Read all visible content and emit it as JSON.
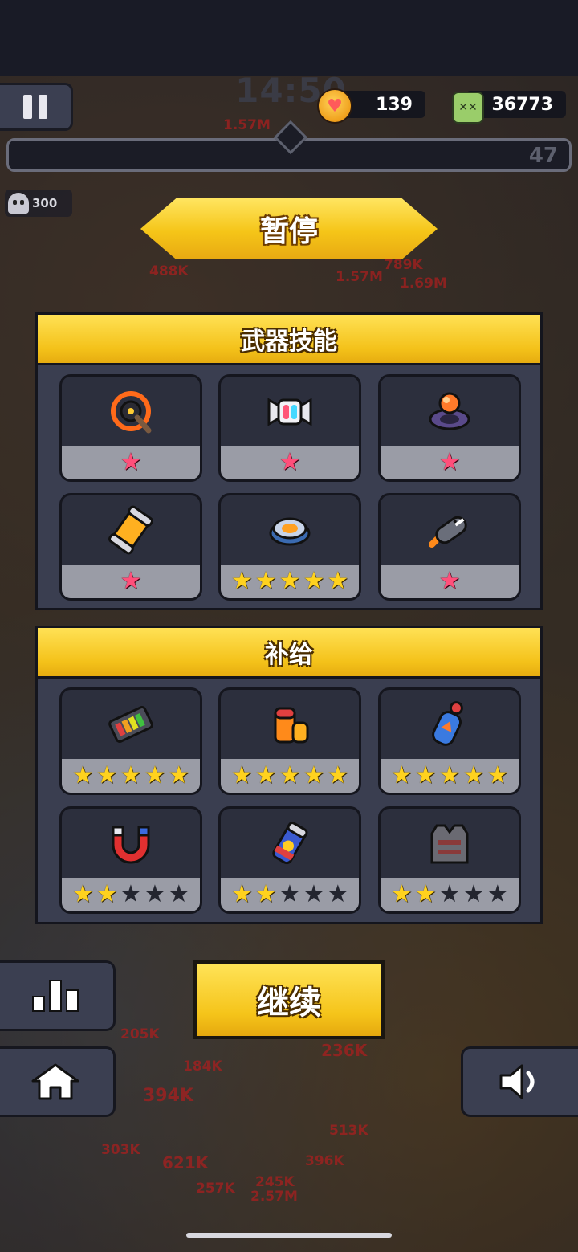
{
  "hud": {
    "timer": "14:50",
    "hearts": "139",
    "kills": "36773",
    "level": "47",
    "ghost_count": "300"
  },
  "dialog": {
    "title": "暂停",
    "weapons_section": {
      "title": "武器技能",
      "items": [
        {
          "icon": "fire-drill-weapon-icon",
          "stars": 1,
          "max": 1,
          "color": "pink"
        },
        {
          "icon": "robot-drone-weapon-icon",
          "stars": 1,
          "max": 1,
          "color": "pink"
        },
        {
          "icon": "orb-turret-weapon-icon",
          "stars": 1,
          "max": 1,
          "color": "pink"
        },
        {
          "icon": "canister-weapon-icon",
          "stars": 1,
          "max": 1,
          "color": "pink"
        },
        {
          "icon": "disc-launcher-weapon-icon",
          "stars": 5,
          "max": 5,
          "color": "gold"
        },
        {
          "icon": "shark-missile-weapon-icon",
          "stars": 1,
          "max": 1,
          "color": "pink"
        }
      ]
    },
    "supply_section": {
      "title": "补给",
      "items": [
        {
          "icon": "battery-pack-icon",
          "stars": 5,
          "max": 5,
          "color": "gold"
        },
        {
          "icon": "fuel-can-icon",
          "stars": 5,
          "max": 5,
          "color": "gold"
        },
        {
          "icon": "spray-bottle-icon",
          "stars": 5,
          "max": 5,
          "color": "gold"
        },
        {
          "icon": "magnet-icon",
          "stars": 2,
          "max": 5,
          "color": "gold"
        },
        {
          "icon": "energy-drink-icon",
          "stars": 2,
          "max": 5,
          "color": "gold"
        },
        {
          "icon": "armor-vest-icon",
          "stars": 2,
          "max": 5,
          "color": "gold"
        }
      ]
    },
    "continue_label": "继续"
  },
  "background_damage": [
    "1.57M",
    "1.57M",
    "1.69M",
    "789K",
    "488K",
    "184K",
    "205K",
    "303K",
    "394K",
    "236K",
    "513K",
    "396K",
    "257K",
    "245K",
    "2.57M",
    "621K"
  ]
}
